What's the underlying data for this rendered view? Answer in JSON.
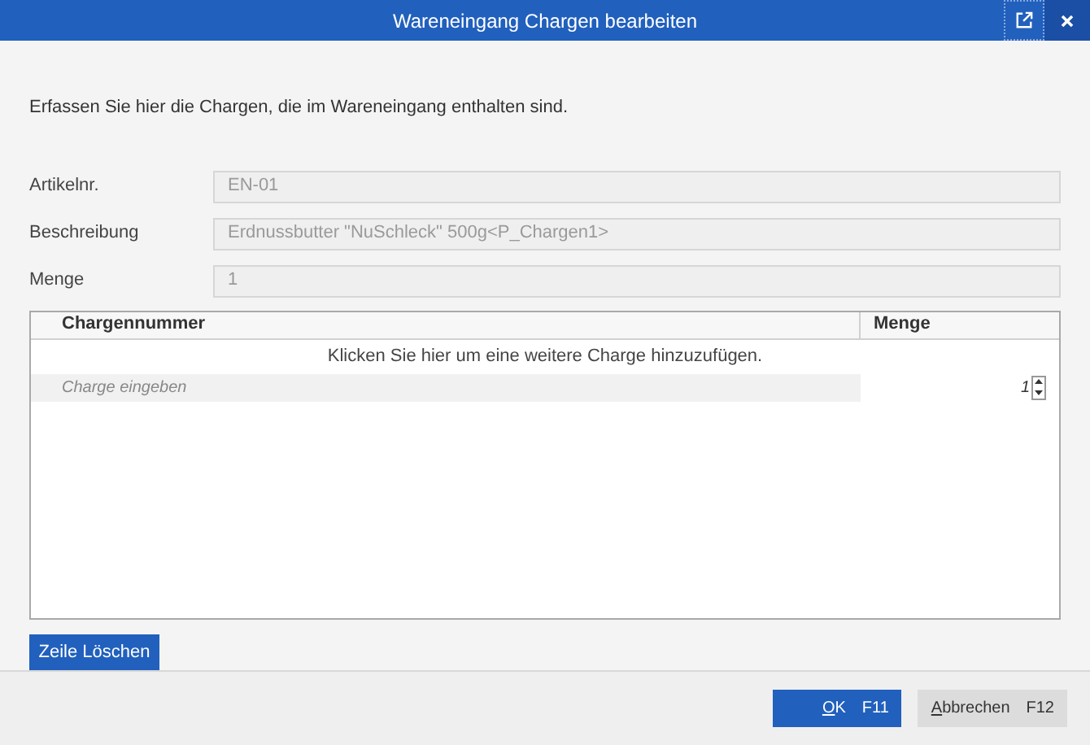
{
  "window": {
    "title": "Wareneingang Chargen bearbeiten"
  },
  "intro": "Erfassen Sie hier die Chargen, die im Wareneingang enthalten sind.",
  "fields": [
    {
      "label": "Artikelnr.",
      "value": "EN-01",
      "disabled": true
    },
    {
      "label": "Beschreibung",
      "value": "Erdnussbutter \"NuSchleck\" 500g<P_Chargen1>",
      "disabled": true
    },
    {
      "label": "Menge",
      "value": "1",
      "disabled": true
    }
  ],
  "table": {
    "columns": [
      "Chargennummer",
      "Menge"
    ],
    "add_hint": "Klicken Sie hier um eine weitere Charge hinzuzufügen.",
    "rows": [
      {
        "placeholder": "Charge eingeben",
        "quantity": "1",
        "selected": true
      }
    ]
  },
  "delete_button": "Zeile Löschen",
  "buttons": [
    {
      "label": "OK",
      "shortcut": "F11",
      "kind": "primary",
      "mnemonic_first": true
    },
    {
      "label": "Abbrechen",
      "shortcut": "F12",
      "kind": "secondary",
      "mnemonic_first": true
    }
  ]
}
